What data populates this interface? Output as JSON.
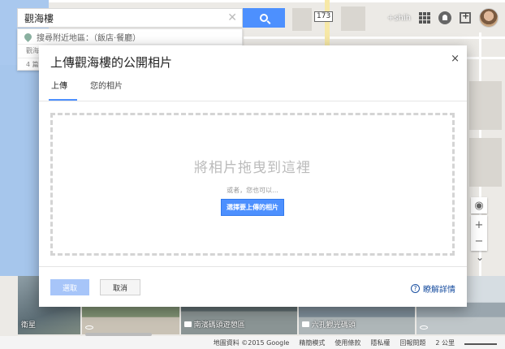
{
  "search": {
    "value": "觀海樓",
    "nearby_hint": "搜尋附近地區：（飯店·餐廳）",
    "partial_rows": [
      "觀海",
      "4 篇"
    ]
  },
  "map": {
    "route_shield": "173",
    "place_label": "+shih"
  },
  "dialog": {
    "title": "上傳觀海樓的公開相片",
    "close_symbol": "×",
    "tabs": [
      {
        "label": "上傳",
        "active": true
      },
      {
        "label": "您的相片",
        "active": false
      }
    ],
    "drop_text": "將相片拖曳到這裡",
    "or_text": "或者，您也可以...",
    "pick_button": "選擇要上傳的相片",
    "select_button": "選取",
    "cancel_button": "取消",
    "learn_more": "瞭解詳情",
    "help_symbol": "?"
  },
  "strip": {
    "thumbs": [
      {
        "caption": "衛星",
        "color": "#6f7f86"
      },
      {
        "caption": "",
        "color": "#8aa7b8"
      },
      {
        "caption": "南濱碼頭遊憩區",
        "color": "#7f8c8f"
      },
      {
        "caption": "六孔觀光碼頭",
        "color": "#9fb0bc"
      },
      {
        "caption": "",
        "color": "#b8c4cc"
      }
    ]
  },
  "footer": {
    "items": [
      "地圖資料 ©2015 Google",
      "精簡模式",
      "使用條款",
      "隱私權",
      "回報問題",
      "2 公里"
    ]
  },
  "controls": {
    "plus": "+",
    "minus": "−",
    "compass": "◉",
    "chevron": "⌄"
  }
}
